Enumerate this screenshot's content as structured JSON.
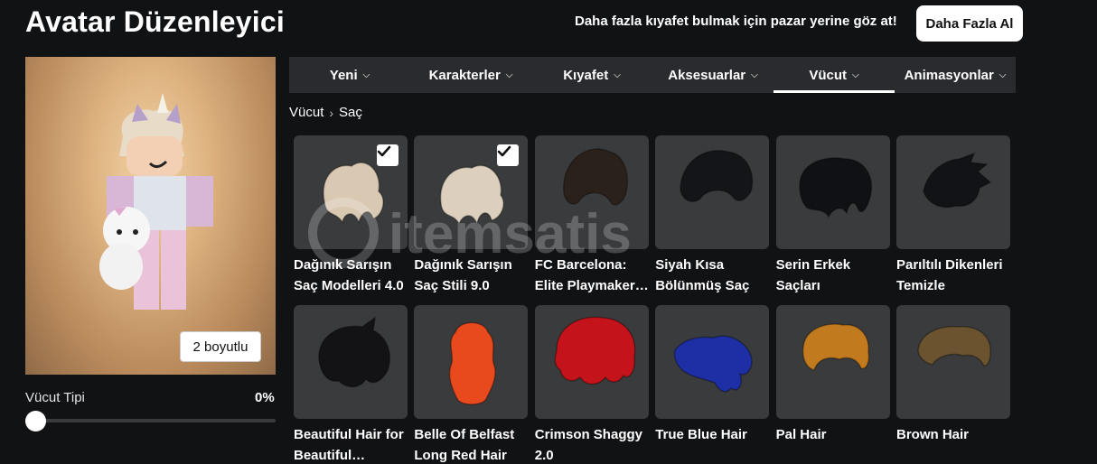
{
  "header": {
    "title": "Avatar Düzenleyici",
    "promo": "Daha fazla kıyafet bulmak için pazar yerine göz at!",
    "get_more_label": "Daha Fazla Al"
  },
  "preview": {
    "toggle_label": "2 boyutlu",
    "body_type_label": "Vücut Tipi",
    "body_type_value": "0%",
    "body_type_level": 0
  },
  "tabs": [
    {
      "label": "Yeni",
      "active": false
    },
    {
      "label": "Karakterler",
      "active": false
    },
    {
      "label": "Kıyafet",
      "active": false
    },
    {
      "label": "Aksesuarlar",
      "active": false
    },
    {
      "label": "Vücut",
      "active": true
    },
    {
      "label": "Animasyonlar",
      "active": false
    }
  ],
  "breadcrumb": {
    "parent": "Vücut",
    "current": "Saç"
  },
  "watermark": "itemsatis",
  "items": [
    {
      "name": "Dağınık Sarışın Saç Modelleri 4.0",
      "checked": true,
      "color": "#d9c8b2"
    },
    {
      "name": "Dağınık Sarışın Saç Stili 9.0",
      "checked": true,
      "color": "#dccfbd"
    },
    {
      "name": "FC Barcelona: Elite Playmaker…",
      "checked": false,
      "color": "#2b211b"
    },
    {
      "name": "Siyah Kısa Bölünmüş Saç",
      "checked": false,
      "color": "#141518"
    },
    {
      "name": "Serin Erkek Saçları",
      "checked": false,
      "color": "#101114"
    },
    {
      "name": "Parıltılı Dikenleri Temizle",
      "checked": false,
      "color": "#121316"
    },
    {
      "name": "Beautiful Hair for Beautiful…",
      "checked": false,
      "color": "#131315"
    },
    {
      "name": "Belle Of Belfast Long Red Hair",
      "checked": false,
      "color": "#e8491d"
    },
    {
      "name": "Crimson Shaggy 2.0",
      "checked": false,
      "color": "#c4131a"
    },
    {
      "name": "True Blue Hair",
      "checked": false,
      "color": "#1e2fa6"
    },
    {
      "name": "Pal Hair",
      "checked": false,
      "color": "#c27a1f"
    },
    {
      "name": "Brown Hair",
      "checked": false,
      "color": "#6b5330"
    }
  ]
}
